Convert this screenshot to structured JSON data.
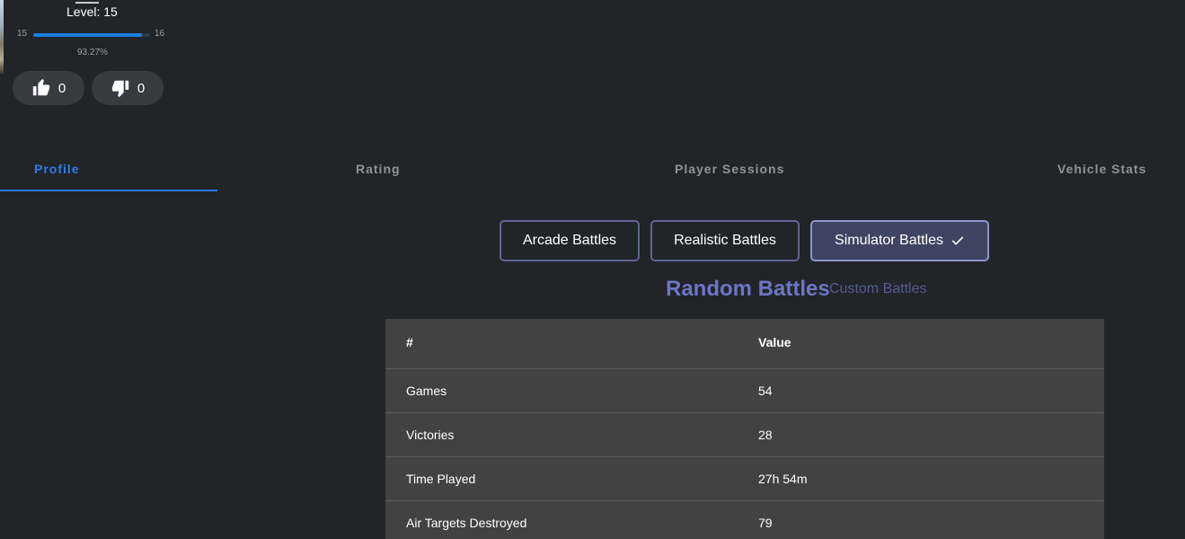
{
  "profile": {
    "level_label": "Level: 15",
    "xp": {
      "min": "15",
      "max": "16",
      "percent_label": "93.27%",
      "progress": 0.9327
    },
    "likes": "0",
    "dislikes": "0"
  },
  "tabs": [
    {
      "label": "Profile",
      "active": true
    },
    {
      "label": "Rating",
      "active": false
    },
    {
      "label": "Player Sessions",
      "active": false
    },
    {
      "label": "Vehicle Stats",
      "active": false
    }
  ],
  "modes": [
    {
      "label": "Arcade Battles",
      "selected": false
    },
    {
      "label": "Realistic Battles",
      "selected": false
    },
    {
      "label": "Simulator Battles",
      "selected": true
    }
  ],
  "battle_types": {
    "random": "Random Battles",
    "custom": "Custom Battles",
    "active": "random"
  },
  "table": {
    "headers": {
      "key": "#",
      "value": "Value"
    },
    "rows": [
      {
        "key": "Games",
        "value": "54"
      },
      {
        "key": "Victories",
        "value": "28"
      },
      {
        "key": "Time Played",
        "value": "27h 54m"
      },
      {
        "key": "Air Targets Destroyed",
        "value": "79"
      }
    ]
  },
  "colors": {
    "background": "#212429",
    "accent": "#2b7de9",
    "mode_border": "#5f658f",
    "mode_selected_bg": "#3f4463",
    "battle_active": "#6c76c4",
    "table_bg": "#424242"
  },
  "icons": {
    "like": "thumbs-up-icon",
    "dislike": "thumbs-down-icon",
    "selected": "check-icon"
  }
}
